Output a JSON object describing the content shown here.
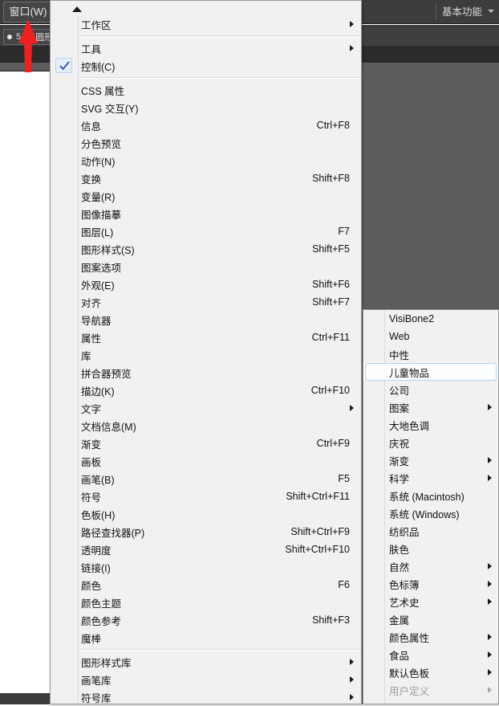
{
  "app": {
    "menu_button_label": "窗口(W)",
    "workspace_switcher_label": "基本功能",
    "stroke_widget": {
      "size": "5",
      "name": "点圆形"
    }
  },
  "window_menu": {
    "name": "窗口菜单",
    "scroll_up_icon": "triangle-up-icon",
    "groups": [
      {
        "items": [
          {
            "label": "工作区",
            "accel": "",
            "submenu": true,
            "checked": false
          }
        ]
      },
      {
        "items": [
          {
            "label": "工具",
            "accel": "",
            "submenu": true,
            "checked": false
          },
          {
            "label": "控制(C)",
            "accel": "",
            "submenu": false,
            "checked": true
          }
        ]
      },
      {
        "items": [
          {
            "label": "CSS 属性",
            "accel": "",
            "submenu": false,
            "checked": false
          },
          {
            "label": "SVG 交互(Y)",
            "accel": "",
            "submenu": false,
            "checked": false
          },
          {
            "label": "信息",
            "accel": "Ctrl+F8",
            "submenu": false,
            "checked": false
          },
          {
            "label": "分色预览",
            "accel": "",
            "submenu": false,
            "checked": false
          },
          {
            "label": "动作(N)",
            "accel": "",
            "submenu": false,
            "checked": false
          },
          {
            "label": "变换",
            "accel": "Shift+F8",
            "submenu": false,
            "checked": false
          },
          {
            "label": "变量(R)",
            "accel": "",
            "submenu": false,
            "checked": false
          },
          {
            "label": "图像描摹",
            "accel": "",
            "submenu": false,
            "checked": false
          },
          {
            "label": "图层(L)",
            "accel": "F7",
            "submenu": false,
            "checked": false
          },
          {
            "label": "图形样式(S)",
            "accel": "Shift+F5",
            "submenu": false,
            "checked": false
          },
          {
            "label": "图案选项",
            "accel": "",
            "submenu": false,
            "checked": false
          },
          {
            "label": "外观(E)",
            "accel": "Shift+F6",
            "submenu": false,
            "checked": false
          },
          {
            "label": "对齐",
            "accel": "Shift+F7",
            "submenu": false,
            "checked": false
          },
          {
            "label": "导航器",
            "accel": "",
            "submenu": false,
            "checked": false
          },
          {
            "label": "属性",
            "accel": "Ctrl+F11",
            "submenu": false,
            "checked": false
          },
          {
            "label": "库",
            "accel": "",
            "submenu": false,
            "checked": false
          },
          {
            "label": "拼合器预览",
            "accel": "",
            "submenu": false,
            "checked": false
          },
          {
            "label": "描边(K)",
            "accel": "Ctrl+F10",
            "submenu": false,
            "checked": false
          },
          {
            "label": "文字",
            "accel": "",
            "submenu": true,
            "checked": false
          },
          {
            "label": "文档信息(M)",
            "accel": "",
            "submenu": false,
            "checked": false
          },
          {
            "label": "渐变",
            "accel": "Ctrl+F9",
            "submenu": false,
            "checked": false
          },
          {
            "label": "画板",
            "accel": "",
            "submenu": false,
            "checked": false
          },
          {
            "label": "画笔(B)",
            "accel": "F5",
            "submenu": false,
            "checked": false
          },
          {
            "label": "符号",
            "accel": "Shift+Ctrl+F11",
            "submenu": false,
            "checked": false
          },
          {
            "label": "色板(H)",
            "accel": "",
            "submenu": false,
            "checked": false
          },
          {
            "label": "路径查找器(P)",
            "accel": "Shift+Ctrl+F9",
            "submenu": false,
            "checked": false
          },
          {
            "label": "透明度",
            "accel": "Shift+Ctrl+F10",
            "submenu": false,
            "checked": false
          },
          {
            "label": "链接(I)",
            "accel": "",
            "submenu": false,
            "checked": false
          },
          {
            "label": "颜色",
            "accel": "F6",
            "submenu": false,
            "checked": false
          },
          {
            "label": "颜色主题",
            "accel": "",
            "submenu": false,
            "checked": false
          },
          {
            "label": "颜色参考",
            "accel": "Shift+F3",
            "submenu": false,
            "checked": false
          },
          {
            "label": "魔棒",
            "accel": "",
            "submenu": false,
            "checked": false
          }
        ]
      },
      {
        "items": [
          {
            "label": "图形样式库",
            "accel": "",
            "submenu": true,
            "checked": false
          },
          {
            "label": "画笔库",
            "accel": "",
            "submenu": true,
            "checked": false
          },
          {
            "label": "符号库",
            "accel": "",
            "submenu": true,
            "checked": false
          }
        ]
      }
    ]
  },
  "swatch_menu": {
    "name": "色板库子菜单",
    "items": [
      {
        "label": "VisiBone2",
        "submenu": false,
        "highlighted": false,
        "disabled": false
      },
      {
        "label": "Web",
        "submenu": false,
        "highlighted": false,
        "disabled": false
      },
      {
        "label": "中性",
        "submenu": false,
        "highlighted": false,
        "disabled": false
      },
      {
        "label": "儿童物品",
        "submenu": false,
        "highlighted": true,
        "disabled": false
      },
      {
        "label": "公司",
        "submenu": false,
        "highlighted": false,
        "disabled": false
      },
      {
        "label": "图案",
        "submenu": true,
        "highlighted": false,
        "disabled": false
      },
      {
        "label": "大地色调",
        "submenu": false,
        "highlighted": false,
        "disabled": false
      },
      {
        "label": "庆祝",
        "submenu": false,
        "highlighted": false,
        "disabled": false
      },
      {
        "label": "渐变",
        "submenu": true,
        "highlighted": false,
        "disabled": false
      },
      {
        "label": "科学",
        "submenu": true,
        "highlighted": false,
        "disabled": false
      },
      {
        "label": "系统 (Macintosh)",
        "submenu": false,
        "highlighted": false,
        "disabled": false
      },
      {
        "label": "系统 (Windows)",
        "submenu": false,
        "highlighted": false,
        "disabled": false
      },
      {
        "label": "纺织品",
        "submenu": false,
        "highlighted": false,
        "disabled": false
      },
      {
        "label": "肤色",
        "submenu": false,
        "highlighted": false,
        "disabled": false
      },
      {
        "label": "自然",
        "submenu": true,
        "highlighted": false,
        "disabled": false
      },
      {
        "label": "色标簿",
        "submenu": true,
        "highlighted": false,
        "disabled": false
      },
      {
        "label": "艺术史",
        "submenu": true,
        "highlighted": false,
        "disabled": false
      },
      {
        "label": "金属",
        "submenu": false,
        "highlighted": false,
        "disabled": false
      },
      {
        "label": "颜色属性",
        "submenu": true,
        "highlighted": false,
        "disabled": false
      },
      {
        "label": "食品",
        "submenu": true,
        "highlighted": false,
        "disabled": false
      },
      {
        "label": "默认色板",
        "submenu": true,
        "highlighted": false,
        "disabled": false
      },
      {
        "label": "用户定义",
        "submenu": true,
        "highlighted": false,
        "disabled": true
      }
    ]
  },
  "annotation": {
    "arrow_color": "#f02020",
    "icon": "arrow-up-icon"
  }
}
